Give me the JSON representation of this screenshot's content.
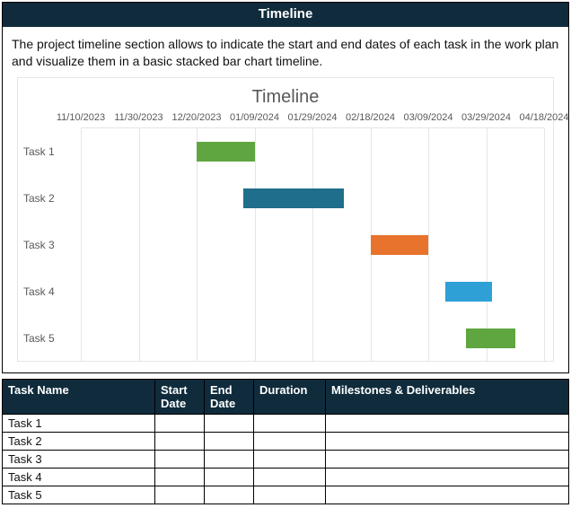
{
  "panel": {
    "title": "Timeline",
    "description": "The project timeline section allows to indicate the start and end dates of each task in the work plan and visualize them in a basic stacked bar chart timeline."
  },
  "chart_data": {
    "type": "bar",
    "title": "Timeline",
    "xlabel": "",
    "ylabel": "",
    "x_ticks": [
      "11/10/2023",
      "11/30/2023",
      "12/20/2023",
      "01/09/2024",
      "01/29/2024",
      "02/18/2024",
      "03/09/2024",
      "03/29/2024",
      "04/18/2024"
    ],
    "categories": [
      "Task 1",
      "Task 2",
      "Task 3",
      "Task 4",
      "Task 5"
    ],
    "series": [
      {
        "name": "Task 1",
        "start": "12/20/2023",
        "end": "01/09/2024",
        "color": "#5fa641"
      },
      {
        "name": "Task 2",
        "start": "01/05/2024",
        "end": "02/09/2024",
        "color": "#1f6e8c"
      },
      {
        "name": "Task 3",
        "start": "02/18/2024",
        "end": "03/09/2024",
        "color": "#e8732c"
      },
      {
        "name": "Task 4",
        "start": "03/15/2024",
        "end": "03/31/2024",
        "color": "#2ea0d6"
      },
      {
        "name": "Task 5",
        "start": "03/22/2024",
        "end": "04/08/2024",
        "color": "#5fa641"
      }
    ]
  },
  "table": {
    "headers": {
      "name": "Task Name",
      "start": "Start Date",
      "end": "End Date",
      "duration": "Duration",
      "milestones": "Milestones & Deliverables"
    },
    "rows": [
      {
        "name": "Task 1",
        "start": "",
        "end": "",
        "duration": "",
        "milestones": ""
      },
      {
        "name": "Task 2",
        "start": "",
        "end": "",
        "duration": "",
        "milestones": ""
      },
      {
        "name": "Task 3",
        "start": "",
        "end": "",
        "duration": "",
        "milestones": ""
      },
      {
        "name": "Task 4",
        "start": "",
        "end": "",
        "duration": "",
        "milestones": ""
      },
      {
        "name": "Task 5",
        "start": "",
        "end": "",
        "duration": "",
        "milestones": ""
      }
    ]
  }
}
